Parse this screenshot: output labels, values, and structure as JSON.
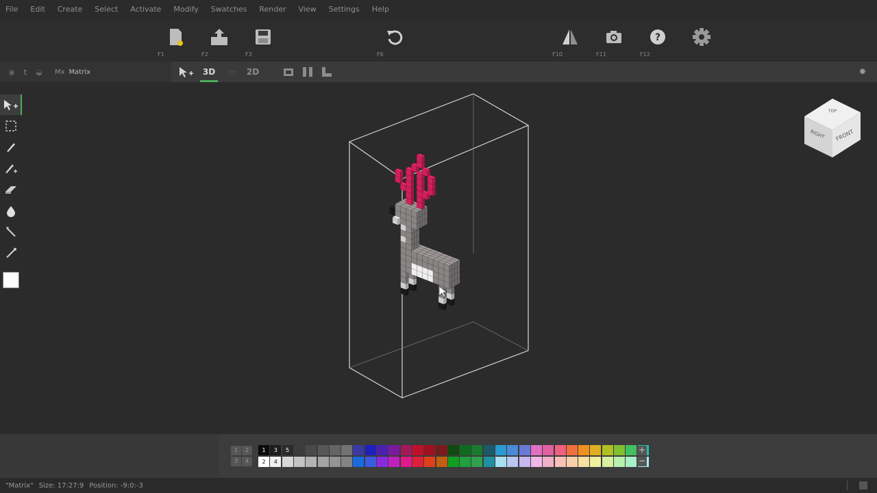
{
  "menu": [
    "File",
    "Edit",
    "Create",
    "Select",
    "Activate",
    "Modify",
    "Swatches",
    "Render",
    "View",
    "Settings",
    "Help"
  ],
  "toolbar": {
    "buttons": [
      {
        "name": "new-file",
        "icon": "new-file-icon",
        "key": "F1"
      },
      {
        "name": "open-file",
        "icon": "open-file-icon",
        "key": "F2"
      },
      {
        "name": "save-file",
        "icon": "save-icon",
        "key": "F3"
      },
      {
        "name": "undo",
        "icon": "undo-icon",
        "key": "F6"
      },
      {
        "name": "mirror",
        "icon": "mirror-icon",
        "key": "F10"
      },
      {
        "name": "screenshot",
        "icon": "camera-icon",
        "key": "F11"
      },
      {
        "name": "help",
        "icon": "help-icon",
        "key": "F12"
      },
      {
        "name": "settings",
        "icon": "gear-icon",
        "key": ""
      }
    ]
  },
  "subbar": {
    "matrix_prefix": "Mx",
    "matrix_name": "Matrix",
    "mode_3d": "3D",
    "mode_2d": "2D"
  },
  "tools": [
    "select-tool",
    "marquee-tool",
    "pencil-tool",
    "brush-tool",
    "eraser-tool",
    "fill-tool",
    "line-tool",
    "picker-tool"
  ],
  "viewcube": {
    "top": "TOP",
    "right": "RIGHT",
    "front": "FRONT"
  },
  "palette": {
    "slots": [
      "1",
      "2",
      "3",
      "4"
    ],
    "selected_labels": [
      "1",
      "3",
      "5",
      "2",
      "4"
    ],
    "plus": "+",
    "minus": "−",
    "colors": {
      "accent": "#4cae5a",
      "antler": "#d0205a",
      "body": "#8a8585"
    }
  },
  "status": {
    "name": "\"Matrix\"",
    "size": "Size: 17:27:9",
    "position": "Position: -9:0:-3"
  }
}
